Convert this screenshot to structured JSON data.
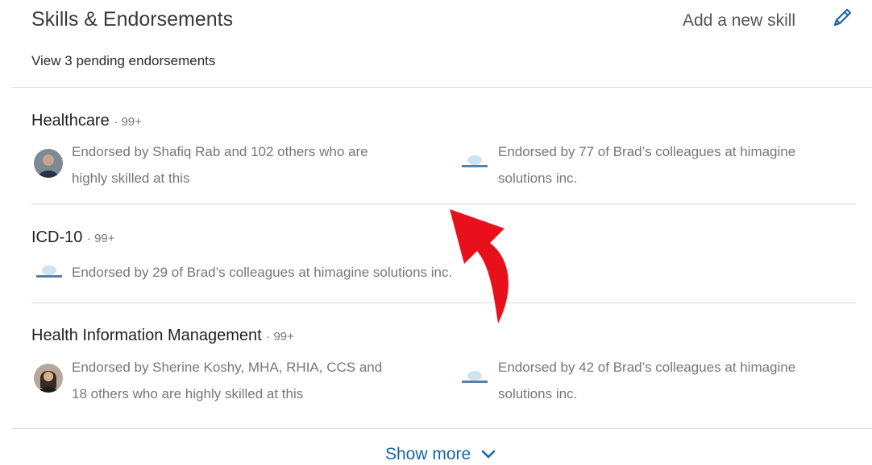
{
  "header": {
    "title": "Skills & Endorsements",
    "add_skill_label": "Add a new skill",
    "pending_label": "View 3 pending endorsements"
  },
  "skills": [
    {
      "name": "Healthcare",
      "count": "· 99+",
      "endorsements": [
        {
          "line1": "Endorsed by Shafiq Rab and 102 others who are",
          "line2": "highly skilled at this",
          "icon": "person-avatar"
        },
        {
          "line1": "Endorsed by 77 of Brad’s colleagues at himagine",
          "line2": "solutions inc.",
          "icon": "company-logo"
        }
      ]
    },
    {
      "name": "ICD-10",
      "count": "· 99+",
      "endorsements": [
        {
          "line1": "Endorsed by 29 of Brad’s colleagues at himagine solutions inc.",
          "icon": "company-logo"
        }
      ]
    },
    {
      "name": "Health Information Management",
      "count": "· 99+",
      "endorsements": [
        {
          "line1": "Endorsed by Sherine Koshy, MHA, RHIA, CCS and",
          "line2": "18 others who are highly skilled at this",
          "icon": "person-avatar"
        },
        {
          "line1": "Endorsed by 42 of Brad’s colleagues at himagine",
          "line2": "solutions inc.",
          "icon": "company-logo"
        }
      ]
    }
  ],
  "footer": {
    "show_more_label": "Show more"
  },
  "colors": {
    "link": "#1b63a8",
    "annotation_arrow": "#e8101a",
    "edit_icon": "#1b63a8"
  }
}
